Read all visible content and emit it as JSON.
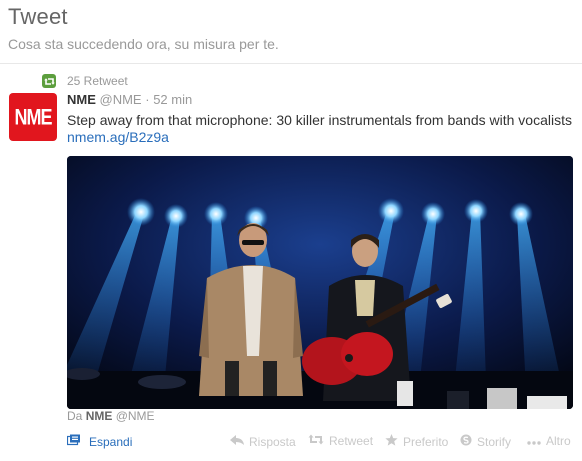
{
  "header": {
    "title": "Tweet",
    "subtitle": "Cosa sta succedendo ora, su misura per te."
  },
  "retweet": {
    "count_label": "25 Retweet",
    "icon": "retweet-icon",
    "color": "#5c9e3d"
  },
  "tweet": {
    "avatar_text": "NME",
    "avatar_color": "#e1161e",
    "display_name": "NME",
    "handle": "@NME",
    "separator": "·",
    "time": "52 min",
    "text": "Step away from that microphone: 30 killer instrumentals from bands with vocalists",
    "link": "nmem.ag/B2z9a",
    "media_alt": "Two musicians on a blue-lit concert stage, one in a trench coat with sunglasses, one playing a red guitar"
  },
  "credit": {
    "prefix": "Da",
    "name": "NME",
    "handle": "@NME"
  },
  "actions": {
    "expand": "Espandi",
    "reply": "Risposta",
    "retweet": "Retweet",
    "favorite": "Preferito",
    "storify": "Storify",
    "more": "Altro"
  },
  "colors": {
    "link": "#2a6ebb",
    "muted": "#999999",
    "action_muted": "#c9c9c9"
  }
}
